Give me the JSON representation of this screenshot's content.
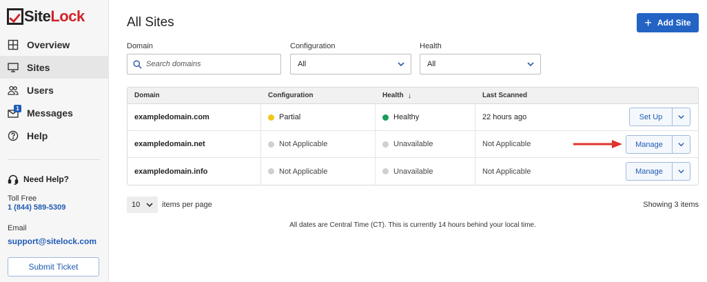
{
  "brand": {
    "logo_site": "Site",
    "logo_lock": "Lock",
    "accent": "#d2232a",
    "primary": "#2363c4"
  },
  "nav": {
    "items": [
      {
        "label": "Overview",
        "icon": "grid-icon"
      },
      {
        "label": "Sites",
        "icon": "monitor-icon",
        "active": true
      },
      {
        "label": "Users",
        "icon": "users-icon"
      },
      {
        "label": "Messages",
        "icon": "mail-icon",
        "badge": "1"
      },
      {
        "label": "Help",
        "icon": "help-circle-icon"
      }
    ]
  },
  "support": {
    "heading": "Need Help?",
    "toll_free_label": "Toll Free",
    "phone": "1 (844) 589-5309",
    "email_label": "Email",
    "email": "support@sitelock.com",
    "submit_label": "Submit Ticket"
  },
  "page": {
    "title": "All Sites",
    "add_label": "Add Site"
  },
  "filters": {
    "domain_label": "Domain",
    "domain_placeholder": "Search domains",
    "config_label": "Configuration",
    "config_value": "All",
    "health_label": "Health",
    "health_value": "All"
  },
  "table": {
    "headers": {
      "domain": "Domain",
      "configuration": "Configuration",
      "health": "Health",
      "last_scanned": "Last Scanned",
      "sort_arrow": "↓"
    },
    "rows": [
      {
        "domain": "exampledomain.com",
        "configuration": "Partial",
        "config_color": "#f5c518",
        "health": "Healthy",
        "health_color": "#1a9c5a",
        "last_scanned": "22 hours ago",
        "action": "Set Up"
      },
      {
        "domain": "exampledomain.net",
        "configuration": "Not Applicable",
        "config_color": "#d0d0d0",
        "health": "Unavailable",
        "health_color": "#d0d0d0",
        "last_scanned": "Not Applicable",
        "action": "Manage"
      },
      {
        "domain": "exampledomain.info",
        "configuration": "Not Applicable",
        "config_color": "#d0d0d0",
        "health": "Unavailable",
        "health_color": "#d0d0d0",
        "last_scanned": "Not Applicable",
        "action": "Manage"
      }
    ]
  },
  "pagination": {
    "per_page": "10",
    "per_page_label": "items per page",
    "showing": "Showing 3 items"
  },
  "footer_note": "All dates are Central Time (CT). This is currently 14 hours behind your local time."
}
